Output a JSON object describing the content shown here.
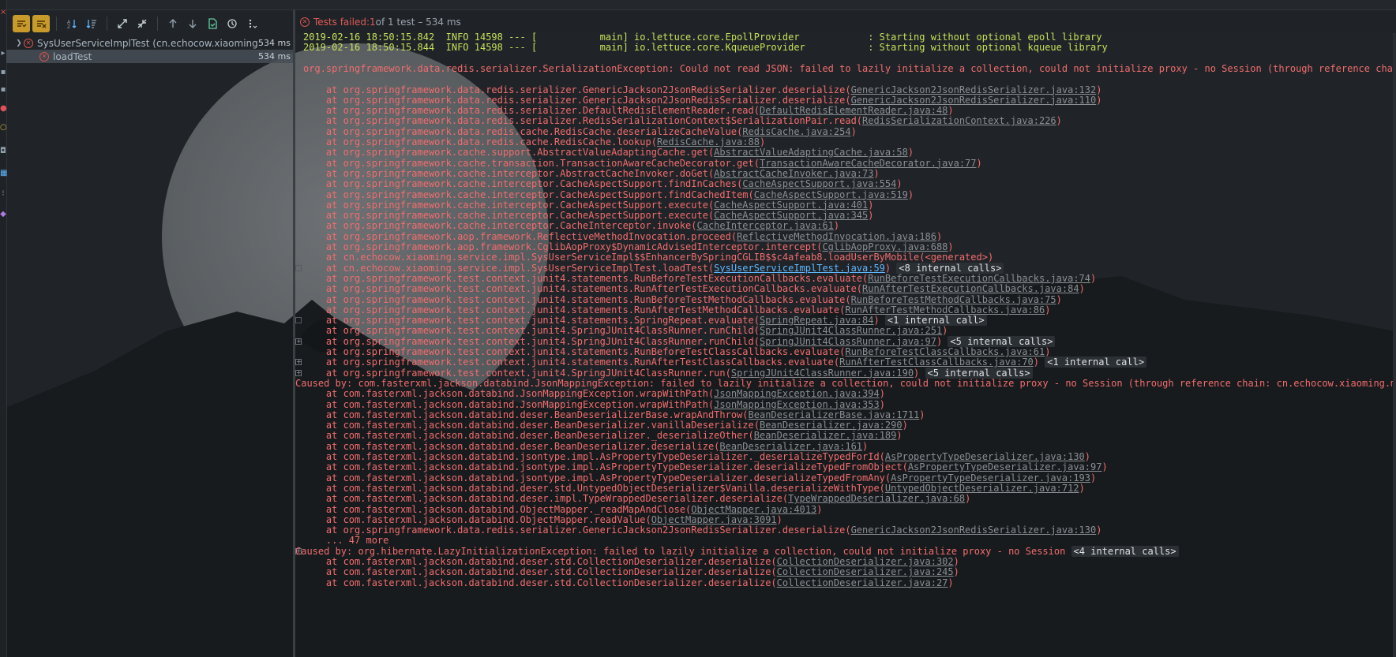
{
  "colors": {
    "background": "#202428",
    "moon": "#6e7275",
    "error_text": "#f26d6d",
    "info_text": "#c8e05a",
    "link_text": "#8a8f93",
    "hot_link": "#5fb7ff",
    "fail_icon": "#d9534f",
    "toolbar_active": "#c89a2b"
  },
  "toolbar": {
    "buttons": [
      {
        "icon": "show-passed-icon",
        "active": true
      },
      {
        "icon": "show-ignored-icon",
        "active": true
      },
      {
        "icon": "sort-alphabetically-icon"
      },
      {
        "icon": "sort-by-duration-icon"
      },
      {
        "icon": "expand-all-icon"
      },
      {
        "icon": "collapse-all-icon"
      },
      {
        "icon": "previous-failed-icon"
      },
      {
        "icon": "next-failed-icon"
      },
      {
        "icon": "export-results-icon"
      },
      {
        "icon": "test-history-icon"
      },
      {
        "icon": "more-options-icon"
      }
    ]
  },
  "tree": {
    "root": {
      "label": "SysUserServiceImplTest (cn.echocow.xiaoming.serv",
      "duration": "534 ms",
      "status": "failed"
    },
    "children": [
      {
        "label": "loadTest",
        "duration": "534 ms",
        "status": "failed"
      }
    ]
  },
  "status_bar": {
    "prefix": "Tests failed: ",
    "failed": "1",
    "suffix": " of 1 test – 534 ms"
  },
  "console": {
    "info_lines": [
      "2019-02-16 18:50:15.842  INFO 14598 --- [           main] io.lettuce.core.EpollProvider            : Starting without optional epoll library",
      "2019-02-16 18:50:15.844  INFO 14598 --- [           main] io.lettuce.core.KqueueProvider           : Starting without optional kqueue library"
    ],
    "exception": "org.springframework.data.redis.serializer.SerializationException: Could not read JSON: failed to lazily initialize a collection, could not initialize proxy - no Session (through reference chain: cn.",
    "frames1": [
      {
        "t": "    at org.springframework.data.redis.serializer.GenericJackson2JsonRedisSerializer.deserialize(",
        "l": "GenericJackson2JsonRedisSerializer.java:132",
        "a": ")"
      },
      {
        "t": "    at org.springframework.data.redis.serializer.GenericJackson2JsonRedisSerializer.deserialize(",
        "l": "GenericJackson2JsonRedisSerializer.java:110",
        "a": ")"
      },
      {
        "t": "    at org.springframework.data.redis.serializer.DefaultRedisElementReader.read(",
        "l": "DefaultRedisElementReader.java:48",
        "a": ")"
      },
      {
        "t": "    at org.springframework.data.redis.serializer.RedisSerializationContext$SerializationPair.read(",
        "l": "RedisSerializationContext.java:226",
        "a": ")"
      },
      {
        "t": "    at org.springframework.data.redis.cache.RedisCache.deserializeCacheValue(",
        "l": "RedisCache.java:254",
        "a": ")"
      },
      {
        "t": "    at org.springframework.data.redis.cache.RedisCache.lookup(",
        "l": "RedisCache.java:88",
        "a": ")"
      },
      {
        "t": "    at org.springframework.cache.support.AbstractValueAdaptingCache.get(",
        "l": "AbstractValueAdaptingCache.java:58",
        "a": ")"
      },
      {
        "t": "    at org.springframework.cache.transaction.TransactionAwareCacheDecorator.get(",
        "l": "TransactionAwareCacheDecorator.java:77",
        "a": ")"
      },
      {
        "t": "    at org.springframework.cache.interceptor.AbstractCacheInvoker.doGet(",
        "l": "AbstractCacheInvoker.java:73",
        "a": ")"
      },
      {
        "t": "    at org.springframework.cache.interceptor.CacheAspectSupport.findInCaches(",
        "l": "CacheAspectSupport.java:554",
        "a": ")"
      },
      {
        "t": "    at org.springframework.cache.interceptor.CacheAspectSupport.findCachedItem(",
        "l": "CacheAspectSupport.java:519",
        "a": ")"
      },
      {
        "t": "    at org.springframework.cache.interceptor.CacheAspectSupport.execute(",
        "l": "CacheAspectSupport.java:401",
        "a": ")"
      },
      {
        "t": "    at org.springframework.cache.interceptor.CacheAspectSupport.execute(",
        "l": "CacheAspectSupport.java:345",
        "a": ")"
      },
      {
        "t": "    at org.springframework.cache.interceptor.CacheInterceptor.invoke(",
        "l": "CacheInterceptor.java:61",
        "a": ")"
      },
      {
        "t": "    at org.springframework.aop.framework.ReflectiveMethodInvocation.proceed(",
        "l": "ReflectiveMethodInvocation.java:186",
        "a": ")"
      },
      {
        "t": "    at org.springframework.aop.framework.CglibAopProxy$DynamicAdvisedInterceptor.intercept(",
        "l": "CglibAopProxy.java:688",
        "a": ")"
      },
      {
        "t": "    at cn.echocow.xiaoming.service.impl.SysUserServiceImpl$$EnhancerBySpringCGLIB$$c4afeab8.loadUserByMobile(<generated>)",
        "l": "",
        "a": ""
      },
      {
        "t": "    at cn.echocow.xiaoming.service.impl.SysUserServiceImplTest.loadTest(",
        "l": "SysUserServiceImplTest.java:59",
        "a": ") ",
        "hot": true,
        "ic": "<8 internal calls>",
        "fold": "empty"
      },
      {
        "t": "    at org.springframework.test.context.junit4.statements.RunBeforeTestExecutionCallbacks.evaluate(",
        "l": "RunBeforeTestExecutionCallbacks.java:74",
        "a": ")"
      },
      {
        "t": "    at org.springframework.test.context.junit4.statements.RunAfterTestExecutionCallbacks.evaluate(",
        "l": "RunAfterTestExecutionCallbacks.java:84",
        "a": ")"
      },
      {
        "t": "    at org.springframework.test.context.junit4.statements.RunBeforeTestMethodCallbacks.evaluate(",
        "l": "RunBeforeTestMethodCallbacks.java:75",
        "a": ")"
      },
      {
        "t": "    at org.springframework.test.context.junit4.statements.RunAfterTestMethodCallbacks.evaluate(",
        "l": "RunAfterTestMethodCallbacks.java:86",
        "a": ")"
      },
      {
        "t": "    at org.springframework.test.context.junit4.statements.SpringRepeat.evaluate(",
        "l": "SpringRepeat.java:84",
        "a": ") ",
        "ic": "<1 internal call>",
        "fold": "empty"
      },
      {
        "t": "    at org.springframework.test.context.junit4.SpringJUnit4ClassRunner.runChild(",
        "l": "SpringJUnit4ClassRunner.java:251",
        "a": ")"
      },
      {
        "t": "    at org.springframework.test.context.junit4.SpringJUnit4ClassRunner.runChild(",
        "l": "SpringJUnit4ClassRunner.java:97",
        "a": ") ",
        "ic": "<5 internal calls>",
        "fold": "plus"
      },
      {
        "t": "    at org.springframework.test.context.junit4.statements.RunBeforeTestClassCallbacks.evaluate(",
        "l": "RunBeforeTestClassCallbacks.java:61",
        "a": ")"
      },
      {
        "t": "    at org.springframework.test.context.junit4.statements.RunAfterTestClassCallbacks.evaluate(",
        "l": "RunAfterTestClassCallbacks.java:70",
        "a": ") ",
        "ic": "<1 internal call>",
        "fold": "plus"
      },
      {
        "t": "    at org.springframework.test.context.junit4.SpringJUnit4ClassRunner.run(",
        "l": "SpringJUnit4ClassRunner.java:190",
        "a": ") ",
        "ic": "<5 internal calls>",
        "fold": "plus"
      }
    ],
    "caused1": "Caused by: com.fasterxml.jackson.databind.JsonMappingException: failed to lazily initialize a collection, could not initialize proxy - no Session (through reference chain: cn.echocow.xiaoming.model",
    "frames2": [
      {
        "t": "    at com.fasterxml.jackson.databind.JsonMappingException.wrapWithPath(",
        "l": "JsonMappingException.java:394",
        "a": ")"
      },
      {
        "t": "    at com.fasterxml.jackson.databind.JsonMappingException.wrapWithPath(",
        "l": "JsonMappingException.java:353",
        "a": ")"
      },
      {
        "t": "    at com.fasterxml.jackson.databind.deser.BeanDeserializerBase.wrapAndThrow(",
        "l": "BeanDeserializerBase.java:1711",
        "a": ")"
      },
      {
        "t": "    at com.fasterxml.jackson.databind.deser.BeanDeserializer.vanillaDeserialize(",
        "l": "BeanDeserializer.java:290",
        "a": ")"
      },
      {
        "t": "    at com.fasterxml.jackson.databind.deser.BeanDeserializer._deserializeOther(",
        "l": "BeanDeserializer.java:189",
        "a": ")"
      },
      {
        "t": "    at com.fasterxml.jackson.databind.deser.BeanDeserializer.deserialize(",
        "l": "BeanDeserializer.java:161",
        "a": ")"
      },
      {
        "t": "    at com.fasterxml.jackson.databind.jsontype.impl.AsPropertyTypeDeserializer._deserializeTypedForId(",
        "l": "AsPropertyTypeDeserializer.java:130",
        "a": ")"
      },
      {
        "t": "    at com.fasterxml.jackson.databind.jsontype.impl.AsPropertyTypeDeserializer.deserializeTypedFromObject(",
        "l": "AsPropertyTypeDeserializer.java:97",
        "a": ")"
      },
      {
        "t": "    at com.fasterxml.jackson.databind.jsontype.impl.AsPropertyTypeDeserializer.deserializeTypedFromAny(",
        "l": "AsPropertyTypeDeserializer.java:193",
        "a": ")"
      },
      {
        "t": "    at com.fasterxml.jackson.databind.deser.std.UntypedObjectDeserializer$Vanilla.deserializeWithType(",
        "l": "UntypedObjectDeserializer.java:712",
        "a": ")"
      },
      {
        "t": "    at com.fasterxml.jackson.databind.deser.impl.TypeWrappedDeserializer.deserialize(",
        "l": "TypeWrappedDeserializer.java:68",
        "a": ")"
      },
      {
        "t": "    at com.fasterxml.jackson.databind.ObjectMapper._readMapAndClose(",
        "l": "ObjectMapper.java:4013",
        "a": ")"
      },
      {
        "t": "    at com.fasterxml.jackson.databind.ObjectMapper.readValue(",
        "l": "ObjectMapper.java:3091",
        "a": ")"
      },
      {
        "t": "    at org.springframework.data.redis.serializer.GenericJackson2JsonRedisSerializer.deserialize(",
        "l": "GenericJackson2JsonRedisSerializer.java:130",
        "a": ")"
      },
      {
        "t": "    ... 47 more",
        "l": "",
        "a": ""
      }
    ],
    "caused2": "Caused by: org.hibernate.LazyInitializationException: failed to lazily initialize a collection, could not initialize proxy - no Session ",
    "caused2_ic": "<4 internal calls>",
    "frames3": [
      {
        "t": "    at com.fasterxml.jackson.databind.deser.std.CollectionDeserializer.deserialize(",
        "l": "CollectionDeserializer.java:302",
        "a": ")"
      },
      {
        "t": "    at com.fasterxml.jackson.databind.deser.std.CollectionDeserializer.deserialize(",
        "l": "CollectionDeserializer.java:245",
        "a": ")"
      },
      {
        "t": "    at com.fasterxml.jackson.databind.deser.std.CollectionDeserializer.deserialize(",
        "l": "CollectionDeserializer.java:27",
        "a": ")"
      }
    ]
  }
}
